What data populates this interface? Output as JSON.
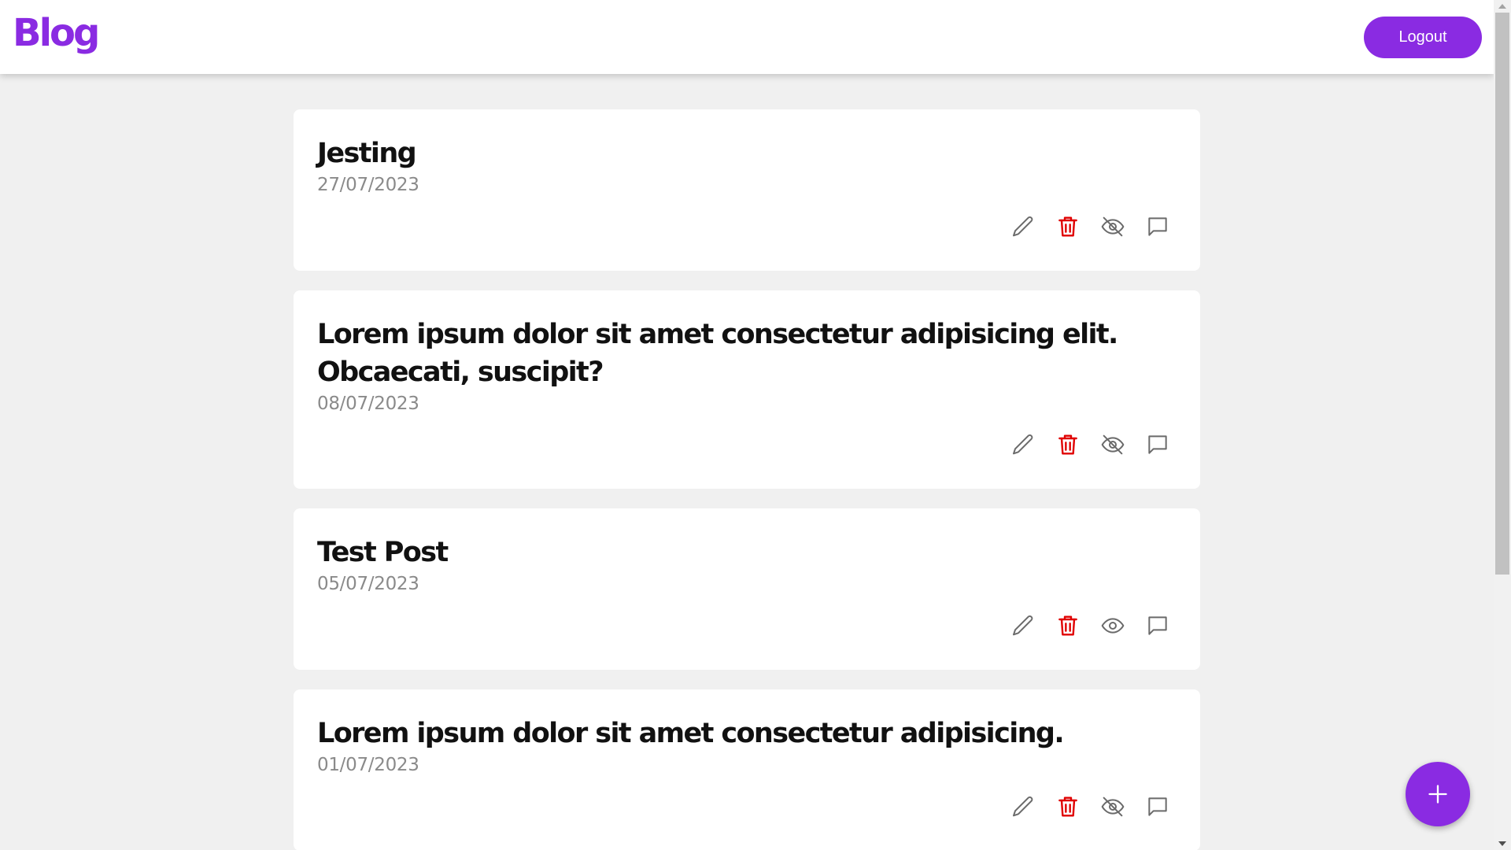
{
  "app": {
    "logo": "Blog"
  },
  "header": {
    "logout_label": "Logout"
  },
  "colors": {
    "accent": "#8a2be2",
    "delete": "#e00000",
    "icon": "#6a6a6a"
  },
  "posts": [
    {
      "title": "Jesting",
      "date": "27/07/2023",
      "visibility_icon": "eye-off-icon"
    },
    {
      "title": "Lorem ipsum dolor sit amet consectetur adipisicing elit. Obcaecati, suscipit?",
      "date": "08/07/2023",
      "visibility_icon": "eye-off-icon"
    },
    {
      "title": "Test Post",
      "date": "05/07/2023",
      "visibility_icon": "eye-icon"
    },
    {
      "title": "Lorem ipsum dolor sit amet consectetur adipisicing.",
      "date": "01/07/2023",
      "visibility_icon": "eye-off-icon"
    }
  ],
  "post_actions": [
    "pencil-icon",
    "trash-icon",
    "visibility-icon",
    "comment-icon"
  ],
  "fab": {
    "icon": "plus-icon"
  }
}
